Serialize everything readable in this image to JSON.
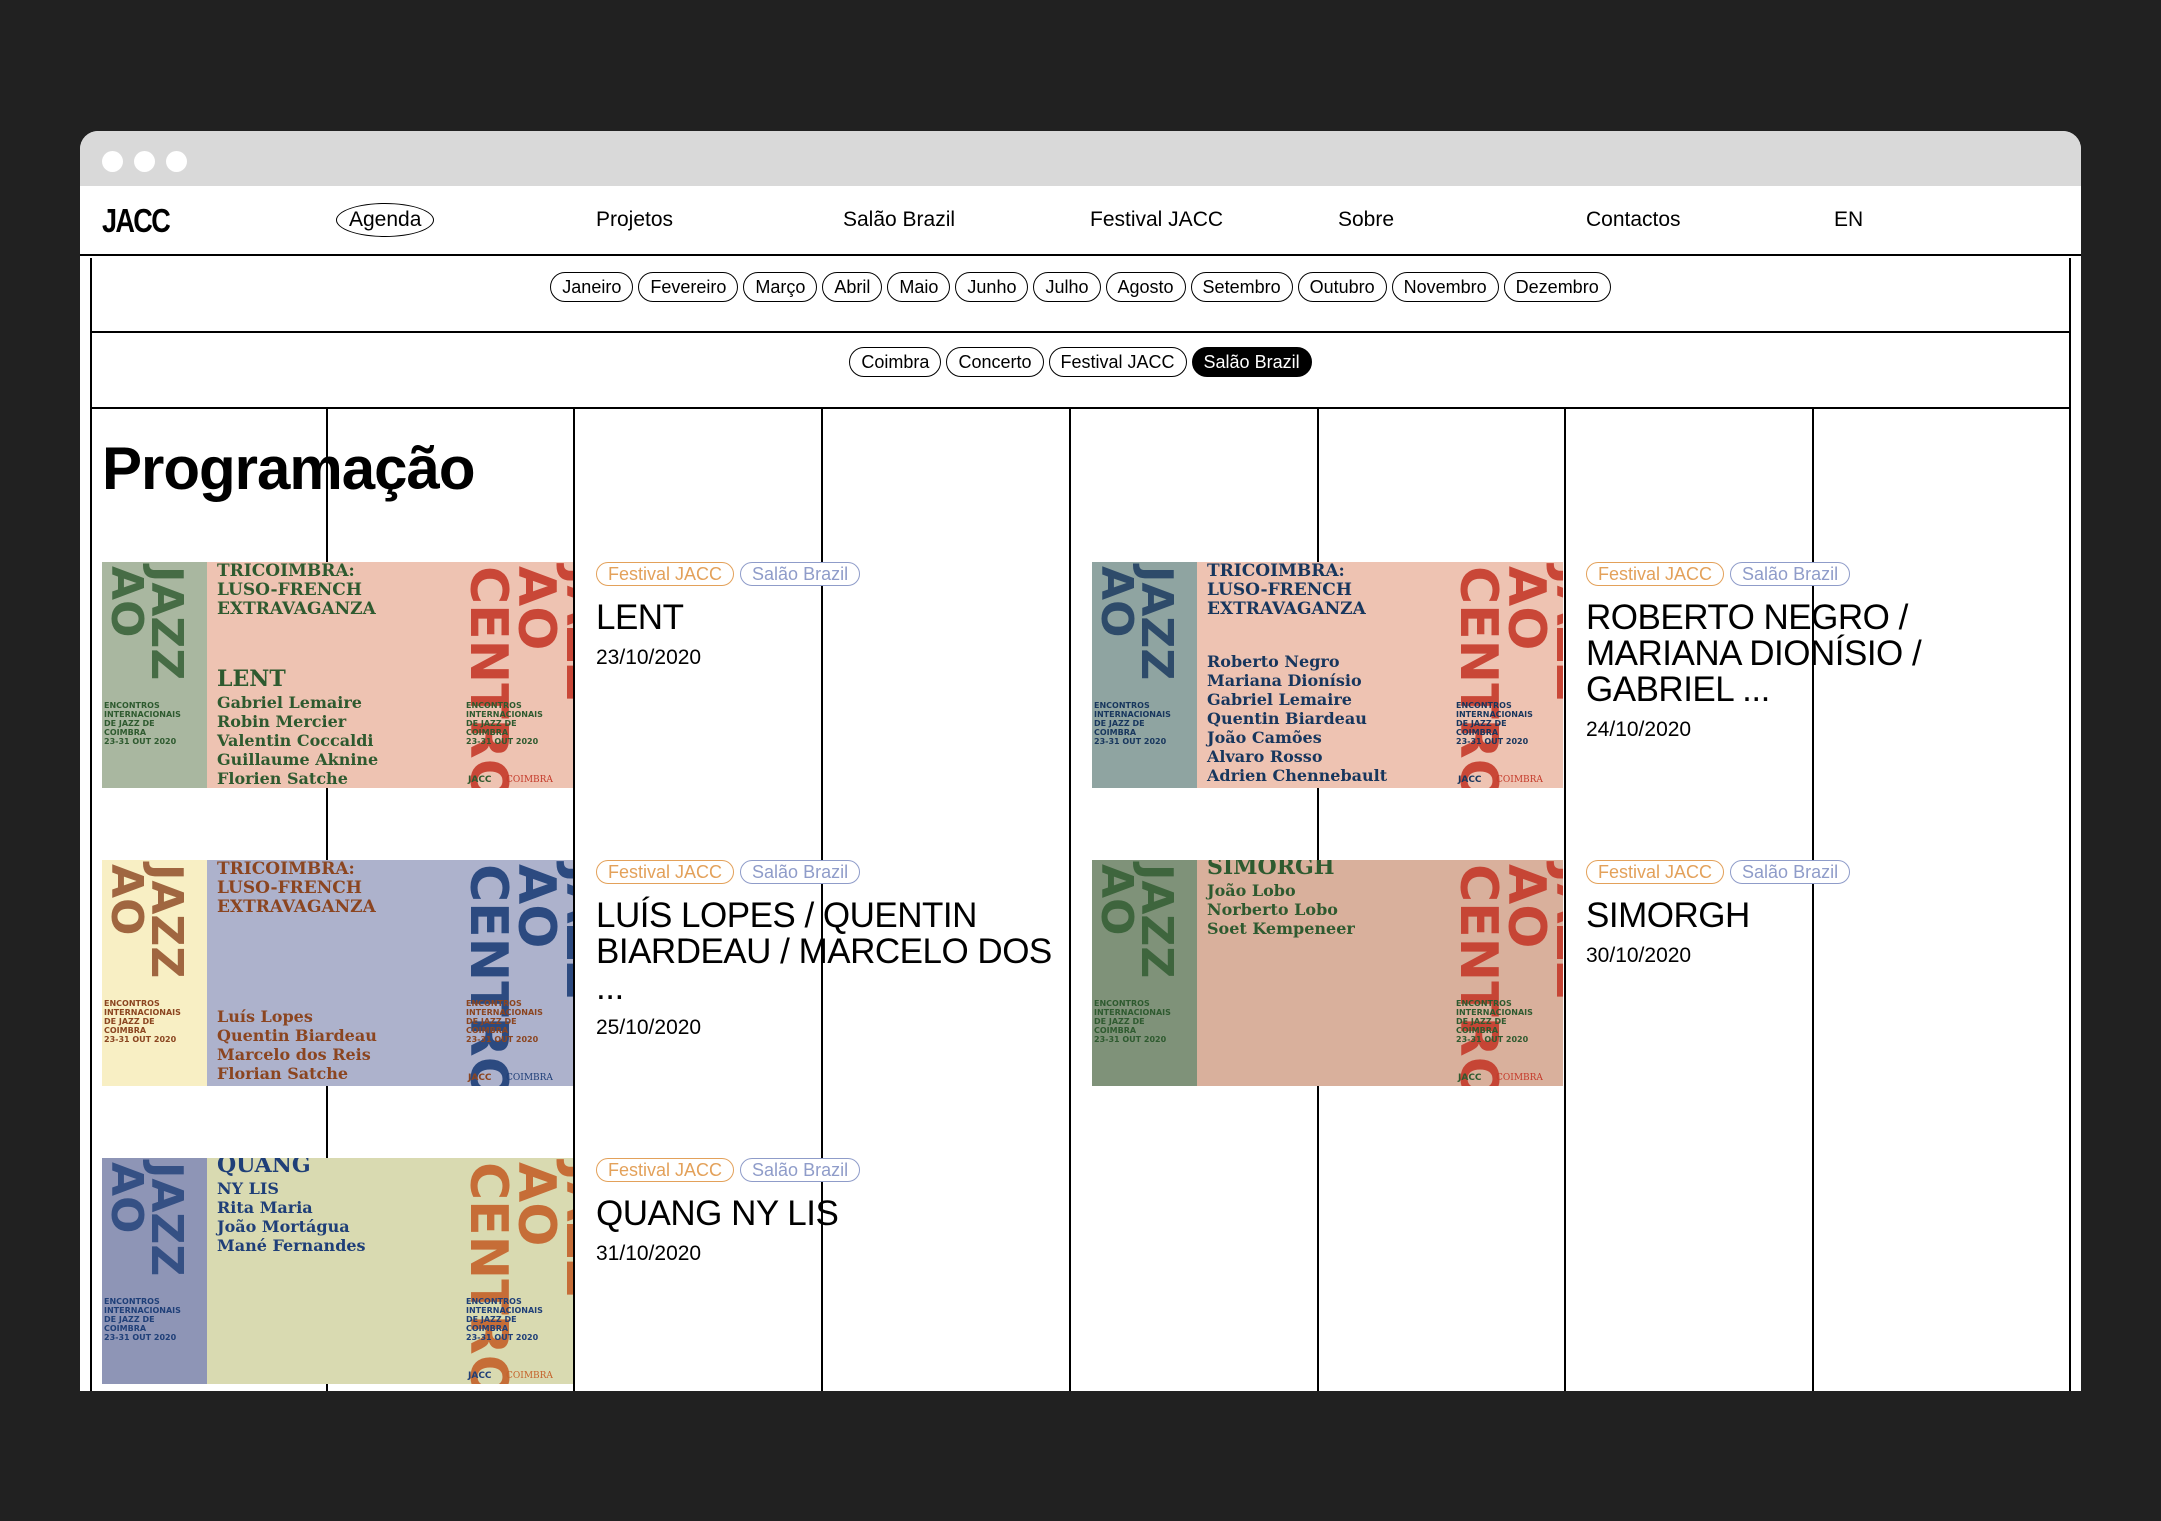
{
  "window": {
    "dots": 3
  },
  "nav": {
    "logo": "JACC",
    "items": [
      {
        "label": "Agenda",
        "active": true
      },
      {
        "label": "Projetos"
      },
      {
        "label": "Salão Brazil"
      },
      {
        "label": "Festival JACC"
      },
      {
        "label": "Sobre"
      },
      {
        "label": "Contactos"
      },
      {
        "label": "EN"
      }
    ]
  },
  "months": [
    "Janeiro",
    "Fevereiro",
    "Março",
    "Abril",
    "Maio",
    "Junho",
    "Julho",
    "Agosto",
    "Setembro",
    "Outubro",
    "Novembro",
    "Dezembro"
  ],
  "categories": [
    {
      "label": "Coimbra",
      "selected": false
    },
    {
      "label": "Concerto",
      "selected": false
    },
    {
      "label": "Festival JACC",
      "selected": false
    },
    {
      "label": "Salão Brazil",
      "selected": true
    }
  ],
  "heading": "Programação",
  "events": [
    {
      "tags": [
        "Festival JACC",
        "Salão Brazil"
      ],
      "title": "LENT",
      "date": "23/10/2020",
      "poster": {
        "colors": {
          "left": "#a9b7a0",
          "main": "#eec3b2",
          "text": "#2e5a2f",
          "big": "#c53a2a"
        },
        "headline": [
          "TRICOIMBRA:",
          "LUSO-FRENCH",
          "EXTRAVAGANZA"
        ],
        "lines": [
          "LENT",
          "Gabriel Lemaire",
          "Robin Mercier",
          "Valentin Coccaldi",
          "Guillaume Aknine",
          "Florien Satche"
        ]
      }
    },
    {
      "tags": [
        "Festival JACC",
        "Salão Brazil"
      ],
      "title": "ROBERTO NEGRO / MARIANA DIONÍSIO / GABRIEL ...",
      "date": "24/10/2020",
      "poster": {
        "colors": {
          "left": "#8fa4a1",
          "main": "#eec3b2",
          "text": "#17365d",
          "big": "#c53a2a"
        },
        "headline": [
          "TRICOIMBRA:",
          "LUSO-FRENCH",
          "EXTRAVAGANZA"
        ],
        "lines": [
          "Roberto Negro",
          "Mariana Dionísio",
          "Gabriel Lemaire",
          "Quentin Biardeau",
          "João Camões",
          "Alvaro Rosso",
          "Adrien Chennebault"
        ]
      }
    },
    {
      "tags": [
        "Festival JACC",
        "Salão Brazil"
      ],
      "title": "LUÍS LOPES / QUENTIN BIARDEAU / MARCELO DOS ...",
      "date": "25/10/2020",
      "poster": {
        "colors": {
          "left": "#f8efc4",
          "main": "#adb2cc",
          "text": "#8b4520",
          "big": "#1f3f78"
        },
        "headline": [
          "TRICOIMBRA:",
          "LUSO-FRENCH",
          "EXTRAVAGANZA"
        ],
        "lines": [
          "Luís Lopes",
          "Quentin Biardeau",
          "Marcelo dos Reis",
          "Florian Satche"
        ]
      }
    },
    {
      "tags": [
        "Festival JACC",
        "Salão Brazil"
      ],
      "title": "SIMORGH",
      "date": "30/10/2020",
      "poster": {
        "colors": {
          "left": "#7f9279",
          "main": "#d9b09c",
          "text": "#2e5a2f",
          "big": "#c53a2a"
        },
        "headline": [],
        "lines": [
          "SIMORGH",
          "João Lobo",
          "Norberto Lobo",
          "Soet Kempeneer"
        ]
      }
    },
    {
      "tags": [
        "Festival JACC",
        "Salão Brazil"
      ],
      "title": "QUANG NY LIS",
      "date": "31/10/2020",
      "poster": {
        "colors": {
          "left": "#8e95b6",
          "main": "#d9dab1",
          "text": "#1f3f78",
          "big": "#c5622a"
        },
        "headline": [],
        "lines": [
          "QUANG",
          "NY LIS",
          "Rita Maria",
          "João Mortágua",
          "Mané Fernandes"
        ]
      }
    }
  ],
  "poster_common": {
    "jazz": "JAZZ",
    "ao": "AO",
    "centro": "CENTRO",
    "festival_name": [
      "ENCONTROS",
      "INTERNACIONAIS",
      "DE JAZZ DE",
      "COIMBRA",
      "23-31 OUT 2020"
    ],
    "footer": [
      "JACC",
      "COIMBRA"
    ]
  }
}
